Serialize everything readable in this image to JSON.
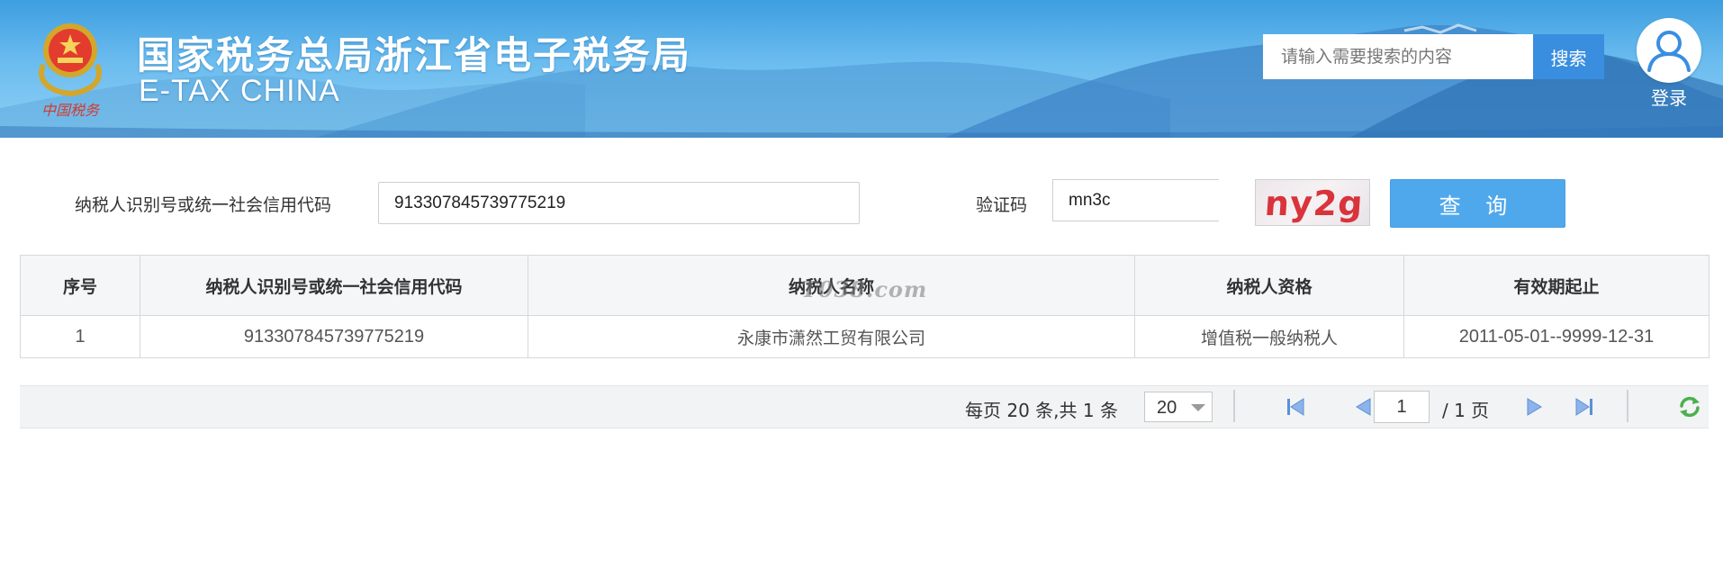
{
  "header": {
    "site_title": "国家税务总局浙江省电子税务局",
    "site_subtitle": "E-TAX CHINA",
    "emblem_caption": "中国税务",
    "search_placeholder": "请输入需要搜索的内容",
    "search_button": "搜索",
    "login_label": "登录"
  },
  "form": {
    "taxid_label": "纳税人识别号或统一社会信用代码",
    "taxid_value": "913307845739775219",
    "captcha_label": "验证码",
    "captcha_value": "mn3c",
    "captcha_image_text": "ny2g",
    "query_button": "查 询"
  },
  "table": {
    "columns": [
      "序号",
      "纳税人识别号或统一社会信用代码",
      "纳税人名称",
      "纳税人资格",
      "有效期起止"
    ],
    "rows": [
      [
        "1",
        "913307845739775219",
        "永康市潇然工贸有限公司",
        "增值税一般纳税人",
        "2011-05-01--9999-12-31"
      ]
    ],
    "watermark": "T038.com"
  },
  "pagination": {
    "summary": "每页 20 条,共 1 条",
    "page_size": "20",
    "current_page": "1",
    "total_pages": "/ 1 页"
  },
  "colors": {
    "primary_button": "#50a8ec",
    "search_button": "#3a8ee0",
    "captcha_text": "#d9333b",
    "header_sky": "#6bbcef",
    "pager_icon": "#5a8fd8",
    "refresh_icon": "#4caf50"
  },
  "icons": {
    "emblem": "national-emblem-icon",
    "avatar": "user-icon",
    "first_page": "first-page-icon",
    "prev_page": "prev-page-icon",
    "next_page": "next-page-icon",
    "last_page": "last-page-icon",
    "refresh": "refresh-icon",
    "dropdown": "chevron-down-icon"
  }
}
